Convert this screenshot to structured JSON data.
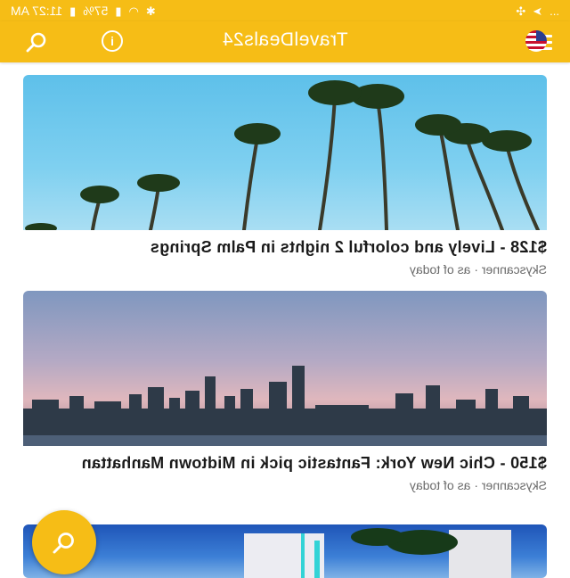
{
  "status_bar": {
    "time": "11:27 AM",
    "battery": "57%",
    "overflow": "..."
  },
  "app_bar": {
    "title": "TravelDeals24",
    "menu_icon": "menu-icon",
    "info_icon": "info-icon",
    "search_icon": "search-icon",
    "flag_icon": "us-flag-icon"
  },
  "deals": [
    {
      "title": "$128 - Lively and colorful 2 nights in Palm Springs",
      "source": "Skyscanner",
      "date": "as of today"
    },
    {
      "title": "$150 - Chic New York: Fantastic pick in Midtown Manhattan",
      "source": "Skyscanner",
      "date": "as of today"
    }
  ],
  "fab": {
    "icon": "search-icon"
  },
  "colors": {
    "accent": "#f6bd16"
  }
}
